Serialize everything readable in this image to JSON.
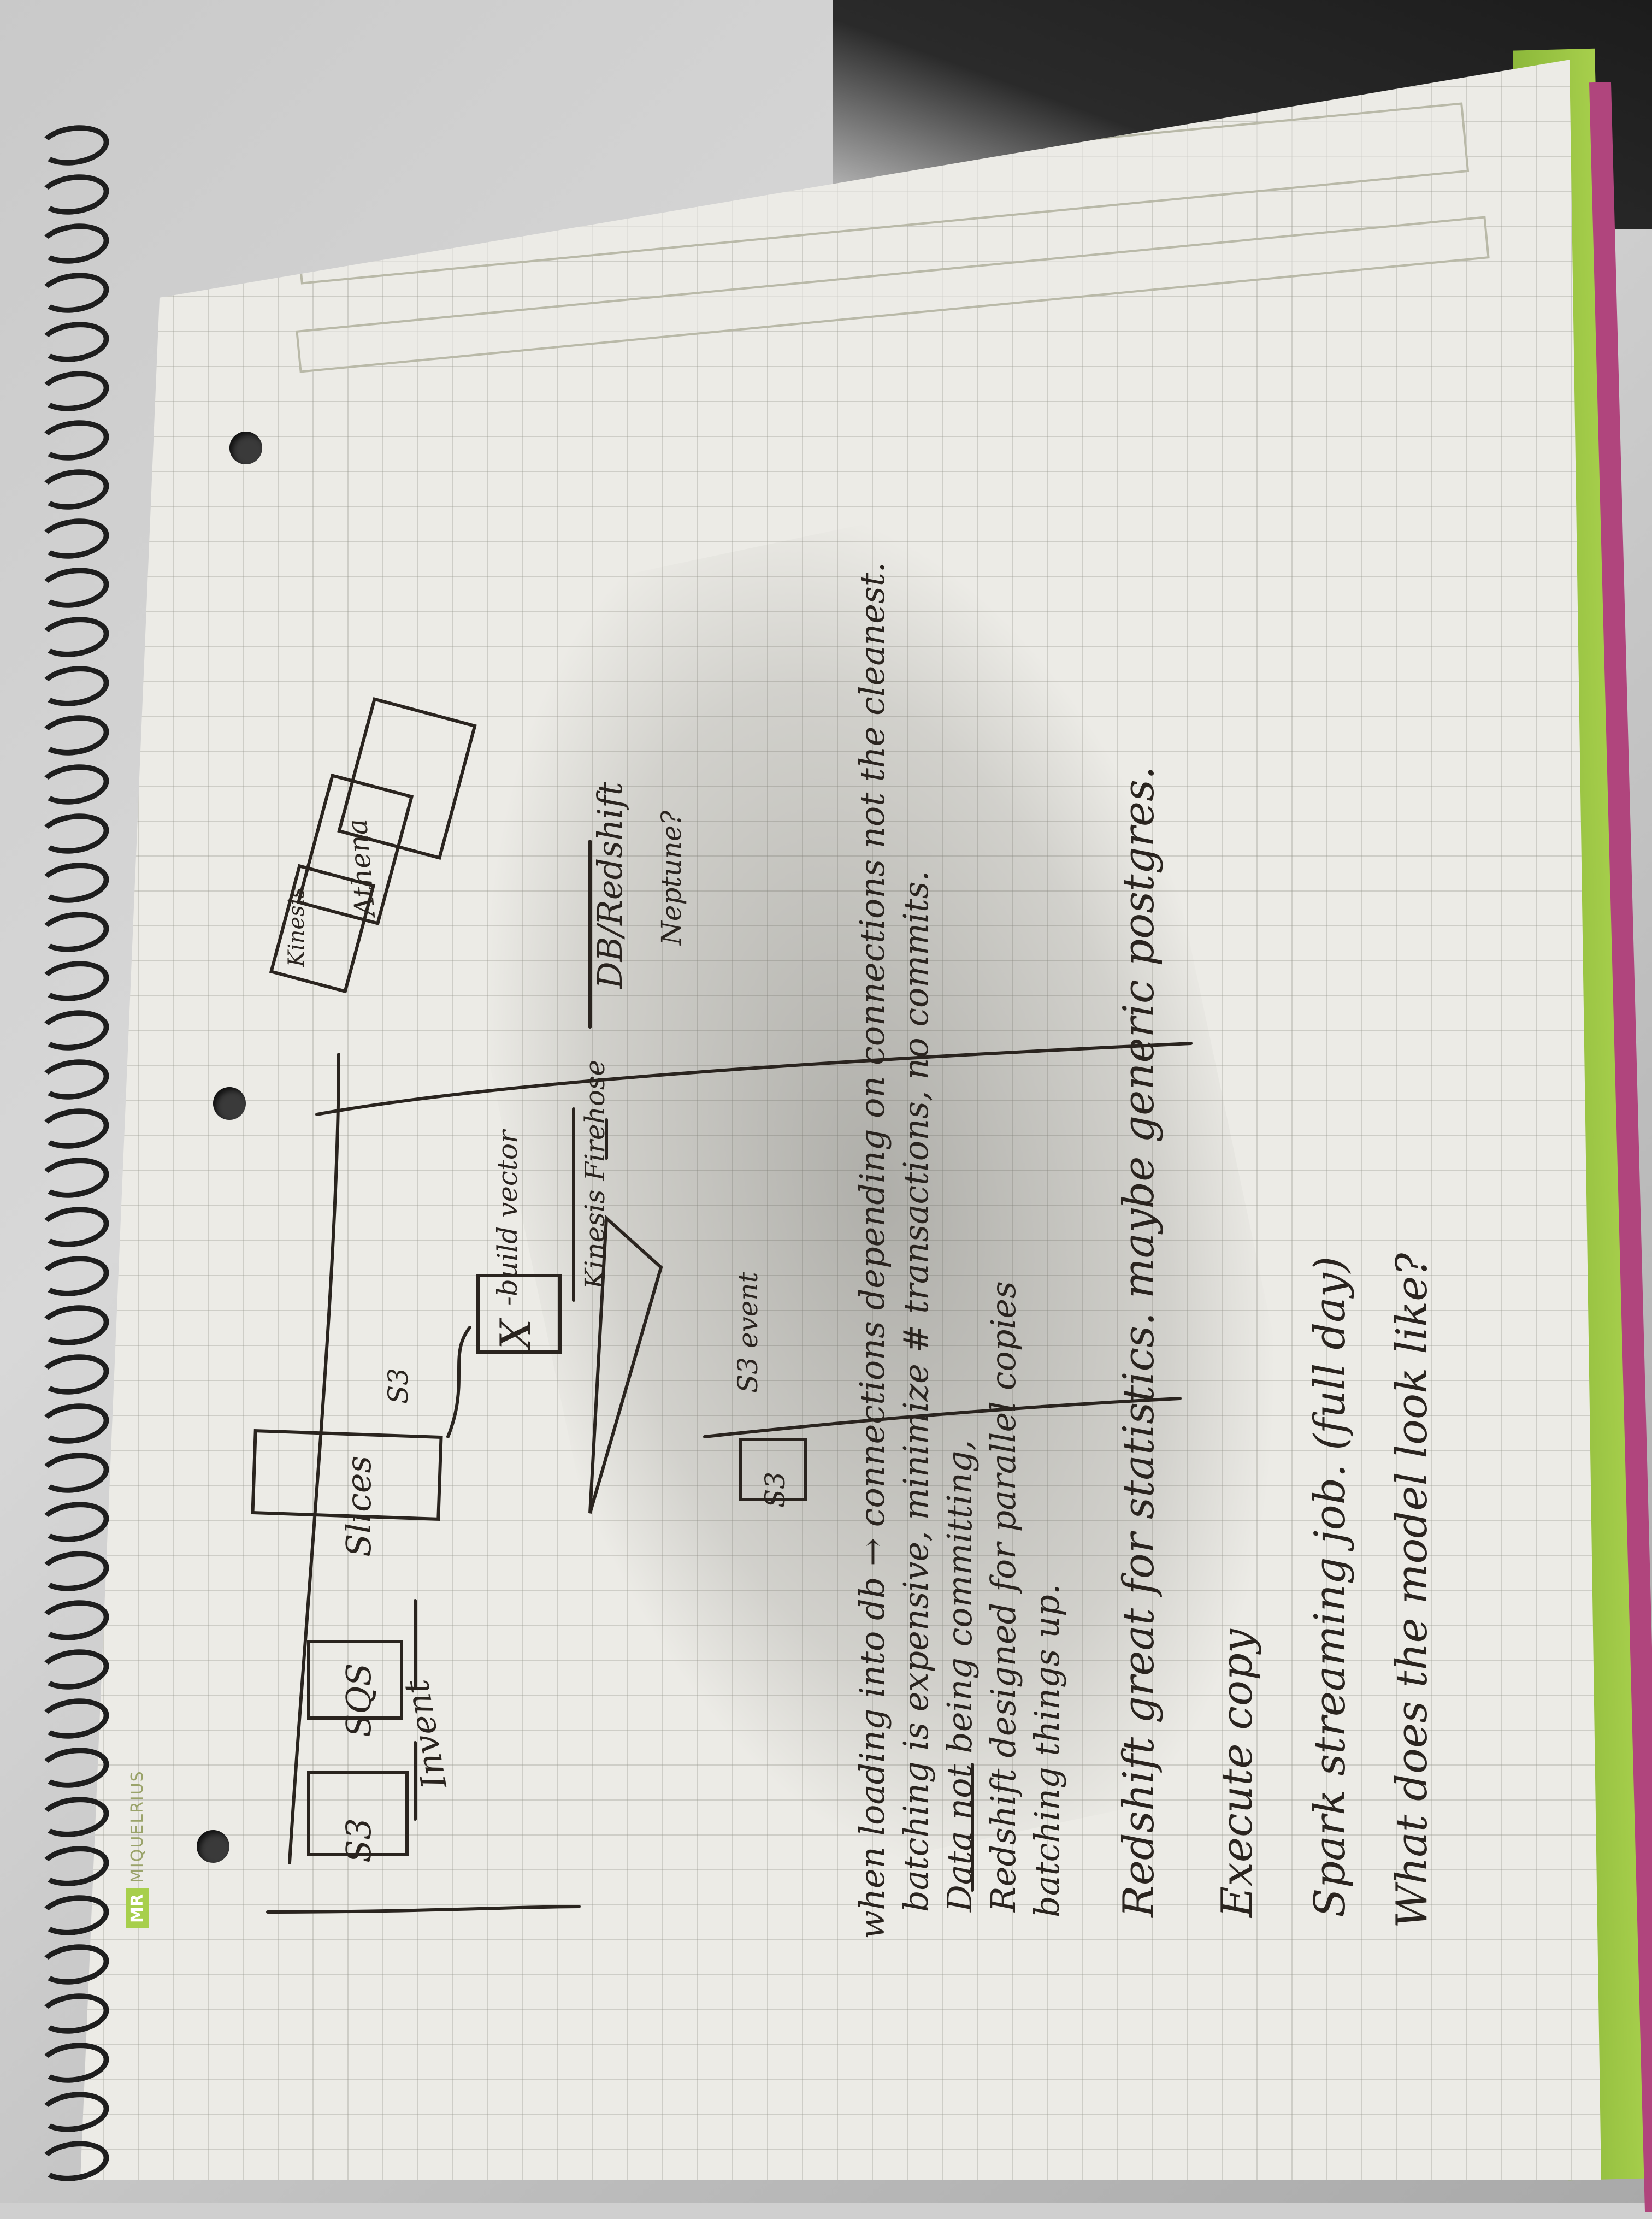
{
  "brand": {
    "logo": "MR",
    "name": "MIQUELRIUS"
  },
  "diagram": {
    "labels": [
      "S3",
      "SQS",
      "Slices",
      "S3",
      "Invent",
      "X",
      "-build vector",
      "Kinesis Firehose",
      "DB/Redshift",
      "Neptune?",
      "Kinesis",
      "Athena",
      "S3 event",
      "S3"
    ]
  },
  "notes": {
    "line1": "when loading into db → connections depending on connections not the cleanest.",
    "line2": "batching is expensive, minimize # transactions, no commits.",
    "line3": "Data not being committing,",
    "line4": "Redshift designed for parallel copies",
    "line5": "batching things up.",
    "line6": "Redshift great for statistics. maybe generic postgres.",
    "line7": "Execute copy",
    "line8": "Spark streaming job. (full day)",
    "line9": "What does the model look like?"
  },
  "colors": {
    "paper": "#ecebe6",
    "grid": "#9a9a8c",
    "ink": "#2a241f",
    "green_edge": "#a7cf4c",
    "pink_edge": "#b0457d"
  }
}
